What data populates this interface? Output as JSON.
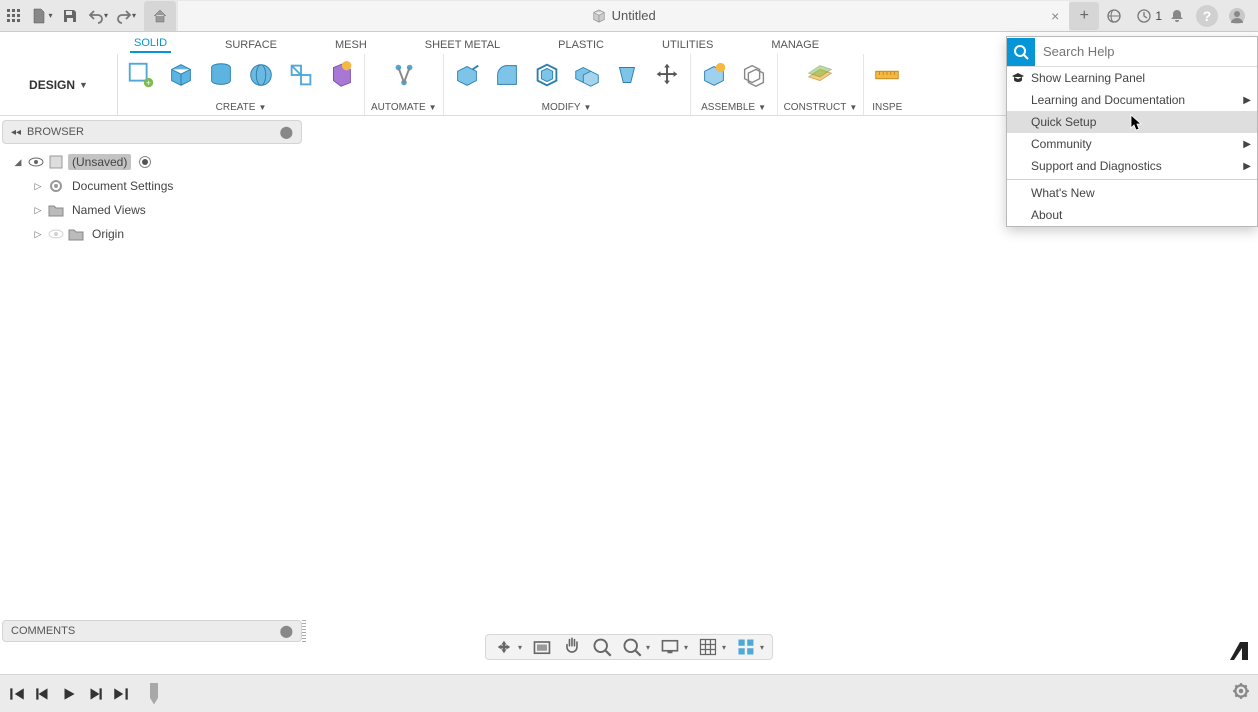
{
  "topbar": {
    "job_count": "1"
  },
  "document": {
    "title": "Untitled"
  },
  "ribbon_tabs": {
    "solid": "SOLID",
    "surface": "SURFACE",
    "mesh": "MESH",
    "sheet_metal": "SHEET METAL",
    "plastic": "PLASTIC",
    "utilities": "UTILITIES",
    "manage": "MANAGE"
  },
  "ribbon": {
    "design_label": "DESIGN",
    "create_label": "CREATE",
    "automate_label": "AUTOMATE",
    "modify_label": "MODIFY",
    "assemble_label": "ASSEMBLE",
    "construct_label": "CONSTRUCT",
    "inspect_label": "INSPE"
  },
  "browser": {
    "header": "BROWSER",
    "root": "(Unsaved)",
    "items": {
      "document_settings": "Document Settings",
      "named_views": "Named Views",
      "origin": "Origin"
    }
  },
  "comments": {
    "header": "COMMENTS"
  },
  "help_menu": {
    "search_placeholder": "Search Help",
    "show_learning_panel": "Show Learning Panel",
    "learning_and_docs": "Learning and Documentation",
    "quick_setup": "Quick Setup",
    "community": "Community",
    "support_diagnostics": "Support and Diagnostics",
    "whats_new": "What's New",
    "about": "About"
  }
}
